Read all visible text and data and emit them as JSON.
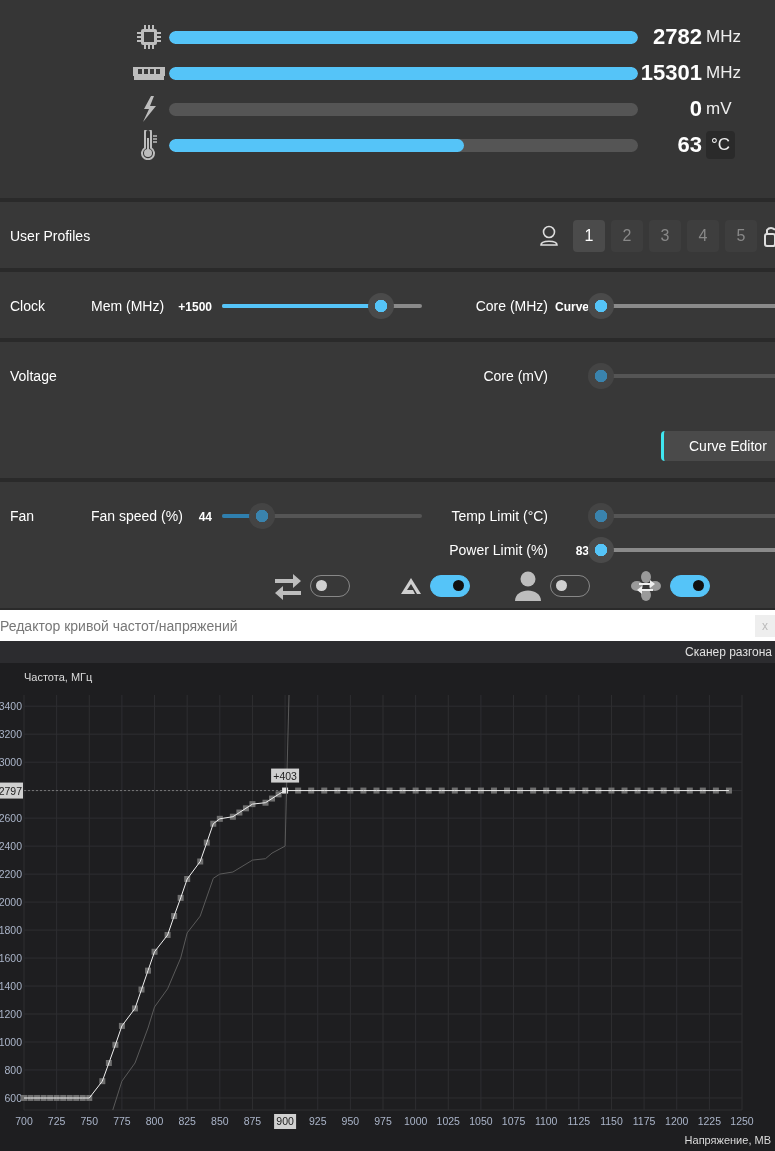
{
  "monitors": [
    {
      "kind": "gpu-clock",
      "value": "2782",
      "unit": "MHz",
      "level": 1
    },
    {
      "kind": "memory-clock",
      "value": "15301",
      "unit": "MHz",
      "level": 1
    },
    {
      "kind": "voltage",
      "value": "0",
      "unit": "mV",
      "level": 0
    },
    {
      "kind": "temperature",
      "value": "63",
      "unit": "°C",
      "level": 0.63
    }
  ],
  "sections": [
    {
      "kind": "profiles",
      "label": "User Profiles",
      "profiles": [
        {
          "label": "1",
          "selected": true
        },
        {
          "label": "2",
          "selected": false
        },
        {
          "label": "3",
          "selected": false
        },
        {
          "label": "4",
          "selected": false
        },
        {
          "label": "5",
          "selected": false
        }
      ]
    },
    {
      "kind": "controls",
      "label": "Clock",
      "left": {
        "name": "Mem (MHz)",
        "value": "+1500",
        "level": 0.795,
        "disabled": false
      },
      "right": [
        {
          "name": "Core (MHz)",
          "value": "Curve",
          "level": 0,
          "disabled": false
        }
      ]
    },
    {
      "kind": "controls",
      "label": "Voltage",
      "right": [
        {
          "name": "Core (mV)",
          "level": 0,
          "disabled": true
        }
      ],
      "button": "Curve Editor"
    },
    {
      "kind": "controls",
      "label": "Fan",
      "left": {
        "name": "Fan speed (%)",
        "value": "44",
        "level": 0.2,
        "disabled": true
      },
      "right": [
        {
          "name": "Temp Limit (°C)",
          "level": 0,
          "disabled": true
        },
        {
          "name": "Power Limit (%)",
          "value": "83",
          "level": 0,
          "disabled": false
        }
      ],
      "toggles": [
        {
          "kind": "sync",
          "on": false
        },
        {
          "kind": "auto",
          "on": true
        },
        {
          "kind": "user",
          "on": false
        },
        {
          "kind": "fan",
          "on": true
        }
      ]
    }
  ],
  "editor": {
    "title": "Редактор кривой частот/напряжений",
    "close": "x",
    "toolbar_button": "Сканер разгона",
    "chart_data": {
      "type": "line",
      "ylabel": "Частота, МГц",
      "xlabel": "Напряжение, МВ",
      "x": [
        700,
        705,
        710,
        715,
        720,
        725,
        730,
        735,
        740,
        745,
        750,
        760,
        765,
        768,
        770,
        775,
        785,
        790,
        795,
        800,
        810,
        815,
        820,
        825,
        835,
        840,
        845,
        850,
        860,
        865,
        870,
        875,
        885,
        890,
        895,
        900,
        903,
        910,
        920,
        930,
        940,
        950,
        960,
        970,
        980,
        990,
        1000,
        1010,
        1020,
        1030,
        1040,
        1050,
        1060,
        1070,
        1080,
        1090,
        1100,
        1110,
        1120,
        1130,
        1140,
        1150,
        1160,
        1170,
        1180,
        1190,
        1200,
        1210,
        1220,
        1230,
        1240
      ],
      "series": [
        {
          "color": "#f0f0f0",
          "marker": "square",
          "values": [
            600,
            600,
            600,
            600,
            600,
            600,
            600,
            600,
            600,
            600,
            600,
            720,
            850,
            null,
            980,
            1115,
            1240,
            1375,
            1510,
            1645,
            1765,
            1900,
            2030,
            2165,
            2290,
            2425,
            2560,
            2595,
            2610,
            2640,
            2670,
            2700,
            2710,
            2740,
            2770,
            2797,
            null,
            2797,
            2797,
            2797,
            2797,
            2797,
            2797,
            2797,
            2797,
            2797,
            2797,
            2797,
            2797,
            2797,
            2797,
            2797,
            2797,
            2797,
            2797,
            2797,
            2797,
            2797,
            2797,
            2797,
            2797,
            2797,
            2797,
            2797,
            2797,
            2797,
            2797,
            2797,
            2797,
            2797,
            2797
          ]
        },
        {
          "color": "#5a5a5a",
          "values": [
            null,
            null,
            null,
            null,
            null,
            null,
            null,
            null,
            null,
            null,
            null,
            null,
            null,
            514,
            null,
            720,
            850,
            null,
            1100,
            1250,
            1380,
            null,
            1600,
            1780,
            1900,
            null,
            2170,
            2200,
            2215,
            null,
            null,
            2300,
            2310,
            2350,
            null,
            2400,
            3480,
            null,
            null,
            null,
            null,
            null,
            null,
            null,
            null,
            null,
            null,
            null,
            null,
            null,
            null,
            null,
            null,
            null,
            null,
            null,
            null,
            null,
            null,
            null,
            null,
            null,
            null,
            null,
            null,
            null,
            null,
            null,
            null,
            null,
            null
          ]
        }
      ],
      "xlim": [
        700,
        1250
      ],
      "ylim": [
        514,
        3480
      ],
      "xticks": [
        700,
        725,
        750,
        775,
        800,
        825,
        850,
        875,
        900,
        925,
        950,
        975,
        1000,
        1025,
        1050,
        1075,
        1100,
        1125,
        1150,
        1175,
        1200,
        1225,
        1250
      ],
      "yticks": [
        3400,
        3200,
        3000,
        2797,
        2600,
        2400,
        2200,
        2000,
        1800,
        1600,
        1400,
        1200,
        1000,
        800,
        600
      ],
      "grid": true,
      "annotations": [
        {
          "x": 900,
          "y": 2797,
          "text": "+403"
        }
      ]
    }
  }
}
